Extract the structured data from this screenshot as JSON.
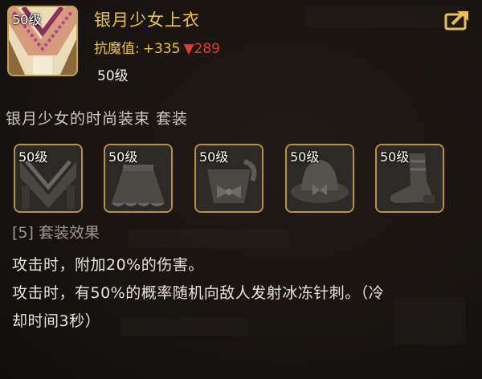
{
  "item": {
    "name": "银月少女上衣",
    "level_badge": "50级",
    "level_text": "50级",
    "stat_label": "抗魔值:",
    "stat_value": "+335",
    "stat_down_arrow": "▼",
    "stat_down_value": "289"
  },
  "share_icon": "share-arrow-icon",
  "set": {
    "title": "银月少女的时尚装束 套装",
    "pieces": [
      {
        "level": "50级",
        "icon": "helmet-cloak-icon"
      },
      {
        "level": "50级",
        "icon": "skirt-icon"
      },
      {
        "level": "50级",
        "icon": "bow-top-icon"
      },
      {
        "level": "50级",
        "icon": "hat-icon"
      },
      {
        "level": "50级",
        "icon": "boot-icon"
      }
    ]
  },
  "effect": {
    "title": "[5] 套装效果",
    "lines": [
      "攻击时，附加20%的伤害。",
      "攻击时，有50%的概率随机向敌人发射冰冻针刺。（冷",
      "却时间3秒）"
    ]
  },
  "colors": {
    "gold": "#f0c43a",
    "down_red": "#e23c2e",
    "border_gold": "#b8923f"
  }
}
